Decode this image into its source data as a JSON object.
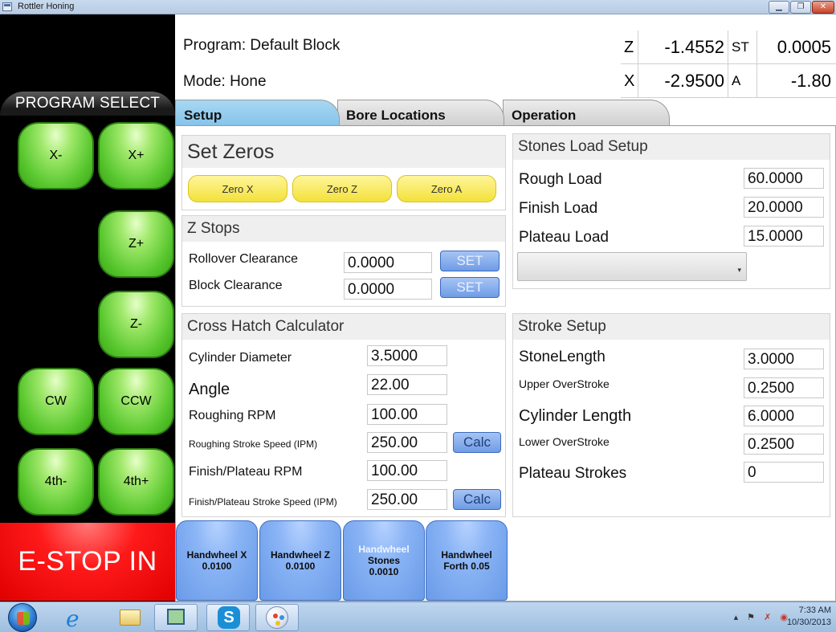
{
  "window": {
    "title": "Rottler Honing",
    "buttons": [
      "minimize",
      "maximize",
      "close"
    ]
  },
  "left_panel": {
    "program_select": "PROGRAM SELECT",
    "buttons": {
      "x_minus": "X-",
      "x_plus": "X+",
      "z_plus": "Z+",
      "z_minus": "Z-",
      "cw": "CW",
      "ccw": "CCW",
      "fourth_minus": "4th-",
      "fourth_plus": "4th+"
    },
    "estop": "E-STOP IN"
  },
  "header": {
    "program": "Program: Default Block",
    "mode": "Mode: Hone",
    "readouts": [
      {
        "axis": "Z",
        "value": "-1.4552",
        "axis2": "ST",
        "value2": "0.0005"
      },
      {
        "axis": "X",
        "value": "-2.9500",
        "axis2": "A",
        "value2": "-1.80"
      }
    ]
  },
  "tabs": [
    {
      "label": "Setup",
      "active": true
    },
    {
      "label": "Bore Locations",
      "active": false
    },
    {
      "label": "Operation",
      "active": false
    }
  ],
  "set_zeros": {
    "title": "Set Zeros",
    "buttons": [
      "Zero X",
      "Zero Z",
      "Zero A"
    ]
  },
  "z_stops": {
    "title": "Z Stops",
    "rows": [
      {
        "label": "Rollover Clearance",
        "value": "0.0000",
        "button": "SET"
      },
      {
        "label": "Block Clearance",
        "value": "0.0000",
        "button": "SET"
      }
    ]
  },
  "cross_hatch": {
    "title": "Cross Hatch Calculator",
    "rows": [
      {
        "label": "Cylinder Diameter",
        "value": "3.5000"
      },
      {
        "label": "Angle",
        "value": "22.00"
      },
      {
        "label": "Roughing RPM",
        "value": "100.00"
      },
      {
        "label": "Roughing Stroke Speed (IPM)",
        "value": "250.00",
        "button": "Calc"
      },
      {
        "label": "Finish/Plateau RPM",
        "value": "100.00"
      },
      {
        "label": "Finish/Plateau Stroke Speed (IPM)",
        "value": "250.00",
        "button": "Calc"
      }
    ]
  },
  "stones_load": {
    "title": "Stones Load Setup",
    "rows": [
      {
        "label": "Rough Load",
        "value": "60.0000"
      },
      {
        "label": "Finish Load",
        "value": "20.0000"
      },
      {
        "label": "Plateau Load",
        "value": "15.0000"
      }
    ],
    "dropdown_value": ""
  },
  "stroke_setup": {
    "title": "Stroke Setup",
    "rows": [
      {
        "label": "StoneLength",
        "value": "3.0000"
      },
      {
        "label": "Upper OverStroke",
        "value": "0.2500"
      },
      {
        "label": "Cylinder Length",
        "value": "6.0000"
      },
      {
        "label": "Lower OverStroke",
        "value": "0.2500"
      },
      {
        "label": "Plateau Strokes",
        "value": "0"
      }
    ]
  },
  "handwheels": [
    {
      "line1": "Handwheel X",
      "line2": "0.0100"
    },
    {
      "line1": "Handwheel Z",
      "line2": "0.0100"
    },
    {
      "line1": "Handwheel",
      "line2": "Stones",
      "line3": "0.0010"
    },
    {
      "line1": "Handwheel",
      "line2": "Forth 0.05"
    }
  ],
  "taskbar": {
    "time": "7:33 AM",
    "date": "10/30/2013",
    "apps": [
      "start-orb",
      "internet-explorer",
      "file-explorer",
      "network-app",
      "skype",
      "paint"
    ]
  }
}
